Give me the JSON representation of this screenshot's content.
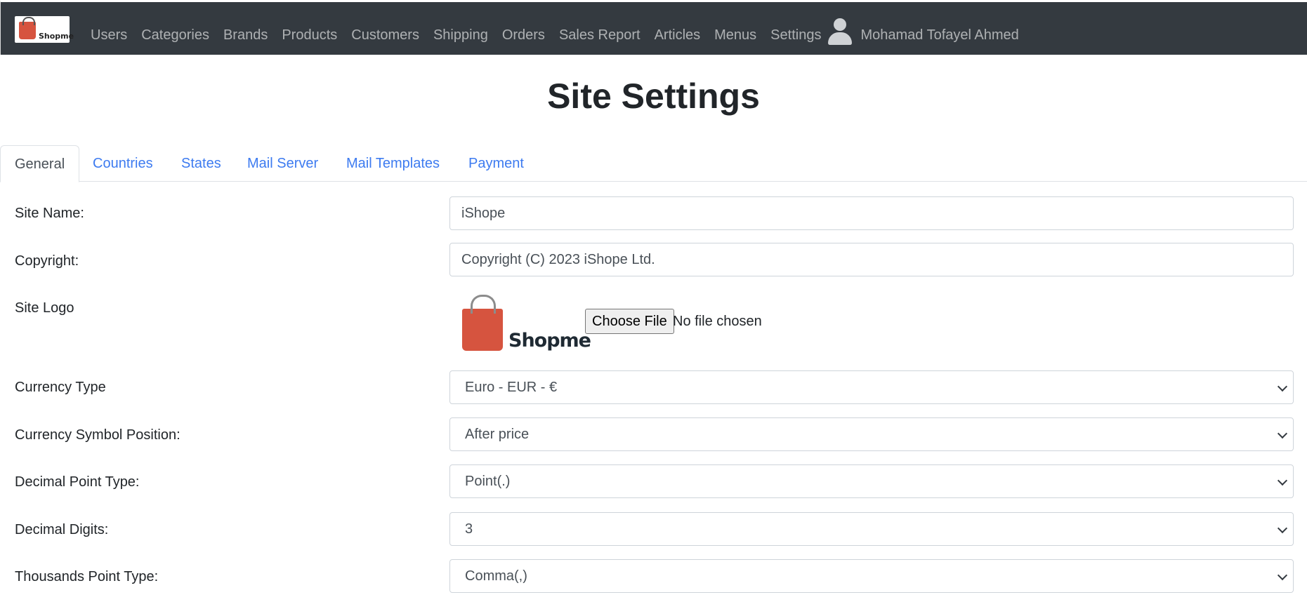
{
  "nav": {
    "brand_text": "Shopme",
    "items": [
      "Users",
      "Categories",
      "Brands",
      "Products",
      "Customers",
      "Shipping",
      "Orders",
      "Sales Report",
      "Articles",
      "Menus",
      "Settings"
    ],
    "user_name": "Mohamad Tofayel Ahmed"
  },
  "page": {
    "title": "Site Settings"
  },
  "tabs": [
    {
      "label": "General",
      "active": true
    },
    {
      "label": "Countries",
      "active": false
    },
    {
      "label": "States",
      "active": false
    },
    {
      "label": "Mail Server",
      "active": false
    },
    {
      "label": "Mail Templates",
      "active": false
    },
    {
      "label": "Payment",
      "active": false
    }
  ],
  "form": {
    "site_name": {
      "label": "Site Name:",
      "value": "iShope"
    },
    "copyright": {
      "label": "Copyright:",
      "value": "Copyright (C) 2023  iShope Ltd."
    },
    "site_logo": {
      "label": "Site Logo",
      "logo_text": "Shopme",
      "choose_button": "Choose File",
      "file_status": "No file chosen"
    },
    "currency_type": {
      "label": "Currency Type",
      "value": "Euro - EUR - €"
    },
    "currency_symbol_position": {
      "label": "Currency Symbol Position:",
      "value": "After price"
    },
    "decimal_point_type": {
      "label": "Decimal Point Type:",
      "value": "Point(.)"
    },
    "decimal_digits": {
      "label": "Decimal Digits:",
      "value": "3"
    },
    "thousands_point_type": {
      "label": "Thousands Point Type:",
      "value": "Comma(,)"
    }
  },
  "colors": {
    "navbar": "#343a40",
    "link": "#3d7bf0",
    "logo_bag": "#d6543f"
  }
}
